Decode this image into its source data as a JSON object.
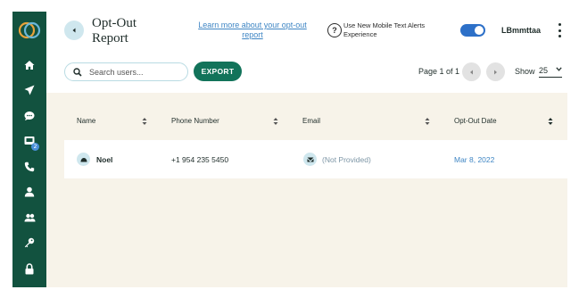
{
  "header": {
    "title": "Opt-Out Report",
    "learn_more_link": "Learn more about your opt-out report",
    "alerts_text": "Use New Mobile Text Alerts Experience",
    "alerts_toggle_on": true,
    "user_name": "LBmmttaa"
  },
  "sidebar": {
    "items": [
      {
        "icon": "home-icon"
      },
      {
        "icon": "send-icon"
      },
      {
        "icon": "chat-icon"
      },
      {
        "icon": "inbox-icon",
        "badge": "2"
      },
      {
        "icon": "phone-icon"
      },
      {
        "icon": "user-icon"
      },
      {
        "icon": "users-icon"
      },
      {
        "icon": "key-icon"
      },
      {
        "icon": "lock-icon"
      }
    ]
  },
  "toolbar": {
    "search_placeholder": "Search users...",
    "export_label": "EXPORT",
    "page_info": "Page 1 of 1",
    "show_label": "Show",
    "page_size": "25"
  },
  "table": {
    "columns": [
      "Name",
      "Phone Number",
      "Email",
      "Opt-Out Date"
    ],
    "rows": [
      {
        "name": "Noel",
        "phone": "+1 954 235 5450",
        "email": "(Not Provided)",
        "date": "Mar 8, 2022"
      }
    ]
  },
  "colors": {
    "sidebar": "#12523f",
    "accent": "#12735a",
    "link": "#3f86c4",
    "content_bg": "#f7f3e9",
    "toggle": "#2d70c8"
  }
}
